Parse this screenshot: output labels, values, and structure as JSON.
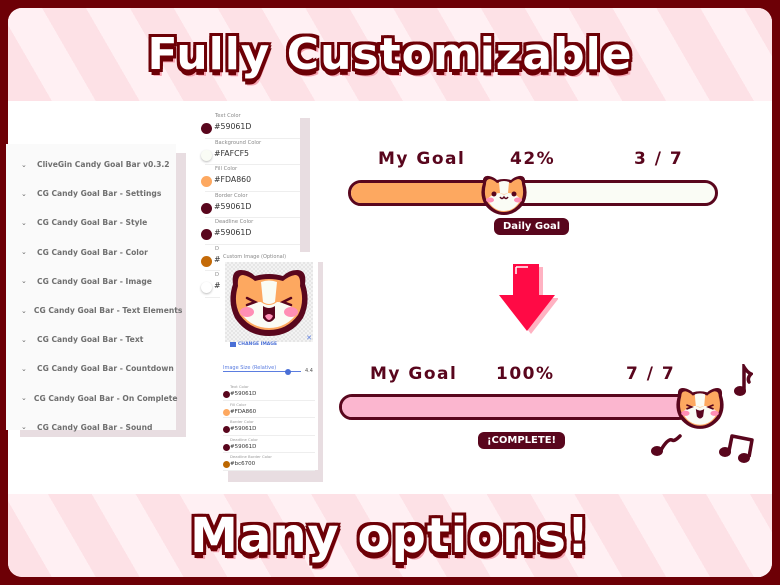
{
  "banners": {
    "top_title": "Fully Customizable",
    "bottom_title": "Many options!"
  },
  "colors": {
    "frame": "#6d0006",
    "text_dark": "#59061d",
    "fill_orange": "#fda860",
    "fill_pink": "#fbb6cf",
    "bar_background": "#fafcf5",
    "arrow": "#ff0a45"
  },
  "settings_panel": {
    "items": [
      {
        "label": "CliveGin Candy Goal Bar v0.3.2"
      },
      {
        "label": "CG Candy Goal Bar - Settings"
      },
      {
        "label": "CG Candy Goal Bar - Style"
      },
      {
        "label": "CG Candy Goal Bar - Color"
      },
      {
        "label": "CG Candy Goal Bar - Image"
      },
      {
        "label": "CG Candy Goal Bar - Text Elements"
      },
      {
        "label": "CG Candy Goal Bar - Text"
      },
      {
        "label": "CG Candy Goal Bar - Countdown"
      },
      {
        "label": "CG Candy Goal Bar - On Complete"
      },
      {
        "label": "CG Candy Goal Bar - Sound"
      }
    ],
    "chevron_icon": "chevron-down-icon"
  },
  "color_panel": {
    "rows": [
      {
        "label": "Text Color",
        "value": "#59061D",
        "swatch": "#59061d"
      },
      {
        "label": "Background Color",
        "value": "#FAFCF5",
        "swatch": "#fafcf5"
      },
      {
        "label": "Fill Color",
        "value": "#FDA860",
        "swatch": "#fda860"
      },
      {
        "label": "Border Color",
        "value": "#59061D",
        "swatch": "#59061d"
      },
      {
        "label": "Deadline Color",
        "value": "#59061D",
        "swatch": "#59061d"
      },
      {
        "label": "D",
        "value": "#",
        "swatch": "#c46a08"
      },
      {
        "label": "D",
        "value": "#",
        "swatch": "#ffffff"
      }
    ]
  },
  "image_panel": {
    "label": "Custom Image (Optional)",
    "change_image": "CHANGE IMAGE",
    "remove_icon": "close-icon",
    "slider_label": "Image Size (Relative)",
    "slider_value": "4.4",
    "slider_fraction": 0.83,
    "rows": [
      {
        "label": "Text Color",
        "value": "#59061D",
        "swatch": "#59061d"
      },
      {
        "label": "Fill Color",
        "value": "#FDA860",
        "swatch": "#fda860"
      },
      {
        "label": "Border Color",
        "value": "#59061D",
        "swatch": "#59061d"
      },
      {
        "label": "Deadline Color",
        "value": "#59061D",
        "swatch": "#59061d"
      },
      {
        "label": "Deadline Border Color",
        "value": "#bc6700",
        "swatch": "#bc6700"
      }
    ]
  },
  "goal_before": {
    "title": "My Goal",
    "percent": "42%",
    "count": "3 / 7",
    "progress": 0.42,
    "badge": "Daily Goal"
  },
  "goal_after": {
    "title": "My Goal",
    "percent": "100%",
    "count": "7 / 7",
    "progress": 1.0,
    "badge": "¡COMPLETE!"
  }
}
